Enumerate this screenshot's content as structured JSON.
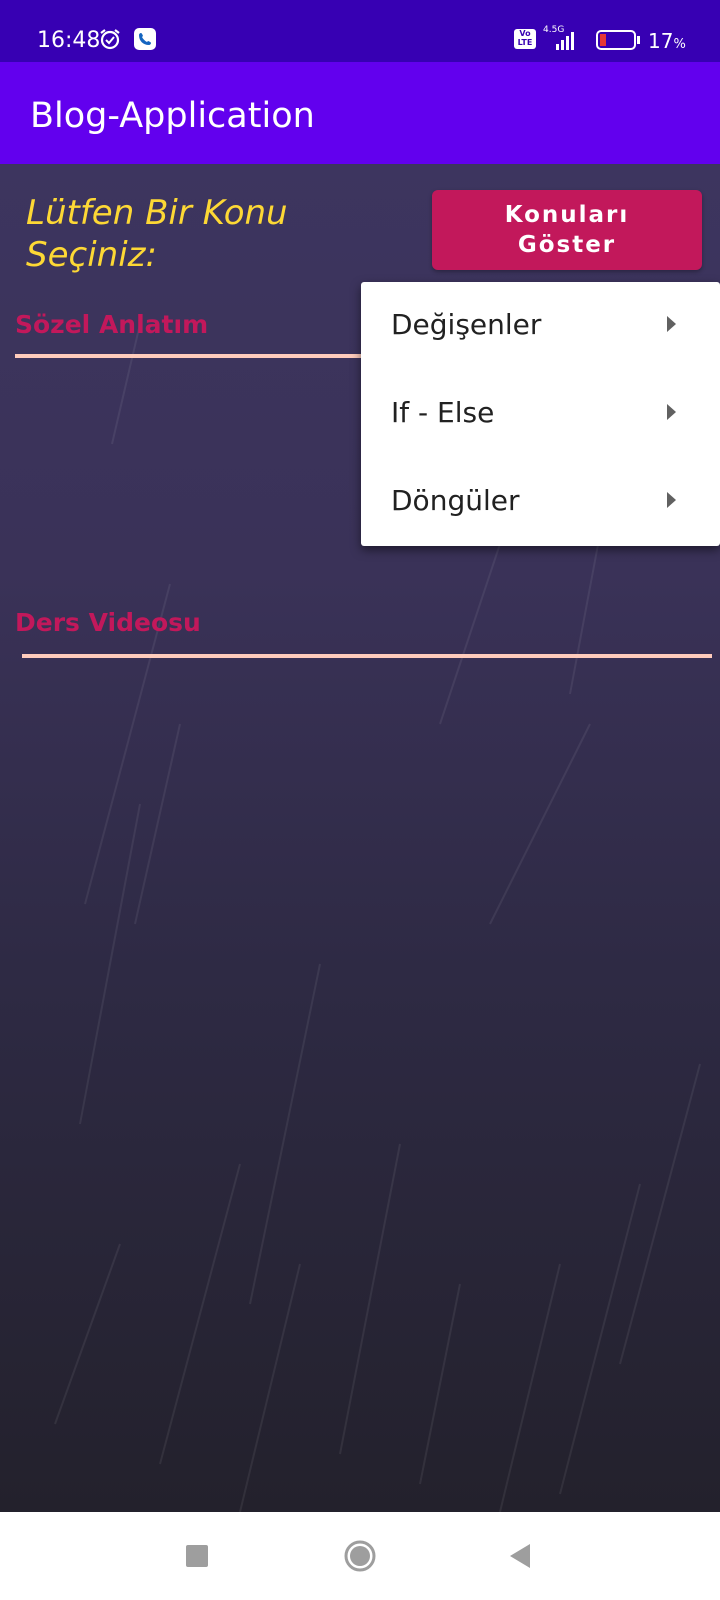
{
  "status_bar": {
    "time": "16:48",
    "network_badge": "Vo\nLTE",
    "network_type": "4.5G",
    "battery_percent": "17",
    "battery_unit": "%",
    "icons": [
      "alarm-icon",
      "phone-app-icon",
      "volte-icon",
      "signal-icon",
      "battery-icon"
    ]
  },
  "app_bar": {
    "title": "Blog-Application"
  },
  "main": {
    "prompt": "Lütfen Bir Konu Seçiniz:",
    "show_button_label": "Konuları Göster",
    "section_text_label": "Sözel Anlatım",
    "section_video_label": "Ders Videosu"
  },
  "menu": {
    "items": [
      {
        "label": "Değişenler",
        "icon": "submenu-arrow-icon"
      },
      {
        "label": "If - Else",
        "icon": "submenu-arrow-icon"
      },
      {
        "label": "Döngüler",
        "icon": "submenu-arrow-icon"
      }
    ]
  },
  "nav_bar": {
    "icons": [
      "recents-icon",
      "home-icon",
      "back-icon"
    ]
  },
  "colors": {
    "status_bar": "#3700b3",
    "app_bar": "#6200ee",
    "accent": "#c2185b",
    "prompt": "#fdd835",
    "divider": "#ffccbc"
  }
}
